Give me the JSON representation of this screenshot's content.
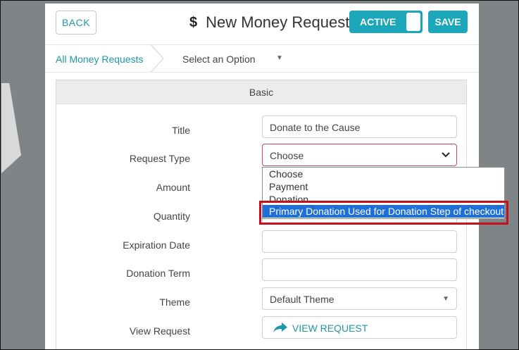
{
  "header": {
    "back_label": "BACK",
    "title_icon": "$",
    "title": "New Money Request",
    "active_label": "ACTIVE",
    "save_label": "SAVE"
  },
  "breadcrumb": {
    "link": "All Money Requests",
    "select_value": "Select an Option"
  },
  "section": {
    "title": "Basic"
  },
  "form": {
    "title_label": "Title",
    "title_value": "Donate to the Cause",
    "request_type_label": "Request Type",
    "request_type_value": "Choose",
    "amount_label": "Amount",
    "quantity_label": "Quantity",
    "expiration_label": "Expiration Date",
    "donation_term_label": "Donation Term",
    "theme_label": "Theme",
    "theme_value": "Default Theme",
    "view_request_label": "View Request",
    "view_request_link": "VIEW REQUEST"
  },
  "dropdown": {
    "options": [
      "Choose",
      "Payment",
      "Donation",
      "Primary Donation Used for Donation Step of checkout"
    ],
    "highlighted_index": 3
  },
  "colors": {
    "accent": "#1ba7b9",
    "link": "#1f97a8",
    "highlight": "#c8101c",
    "selected_option": "#1e70d8"
  }
}
